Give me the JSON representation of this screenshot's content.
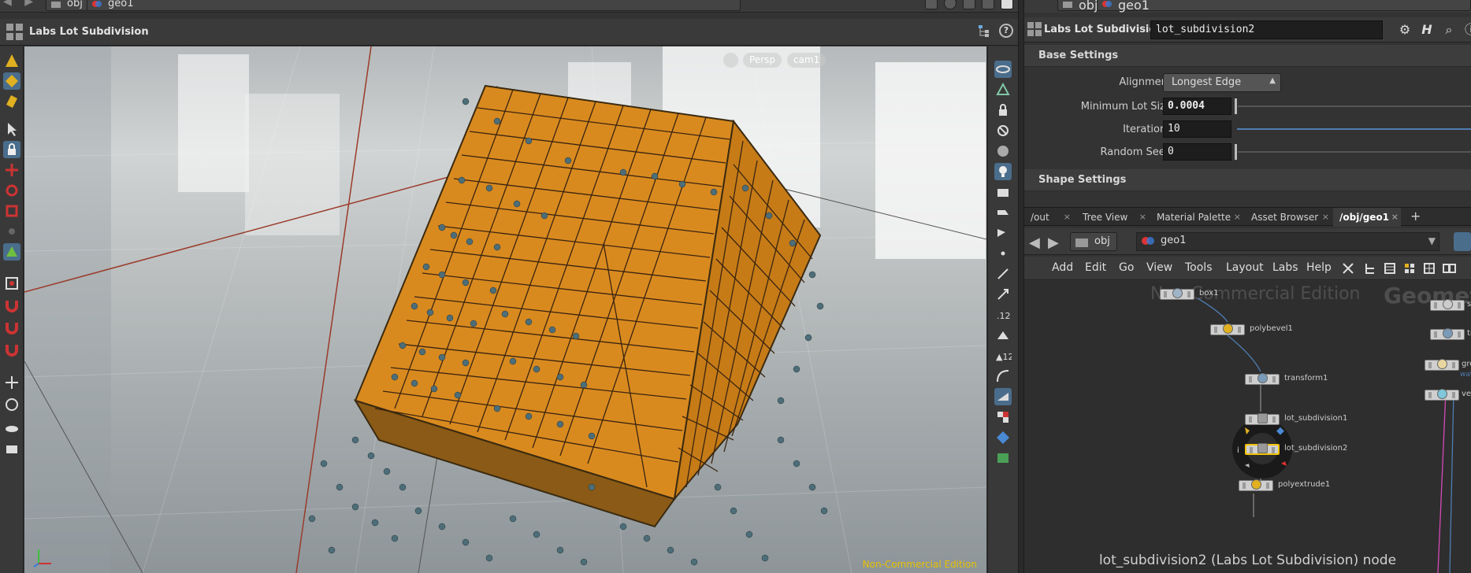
{
  "viewer": {
    "top_path": {
      "crumb_obj": "obj",
      "crumb_geo": "geo1"
    },
    "title": "Labs Lot Subdivision",
    "help_label": "?",
    "view_chips": {
      "persp": "Persp",
      "camera": "cam1"
    },
    "watermark": "Non-Commercial Edition"
  },
  "params": {
    "top_path": {
      "crumb_obj": "obj",
      "crumb_geo": "geo1"
    },
    "title": "Labs Lot Subdivision",
    "node_name": "lot_subdivision2",
    "folders": {
      "base": "Base Settings",
      "shape": "Shape Settings"
    },
    "alignment": {
      "label": "Alignment",
      "value": "Longest Edge"
    },
    "min_lot_size": {
      "label": "Minimum Lot Size",
      "value": "0.0004"
    },
    "iterations": {
      "label": "Iterations",
      "value": "10"
    },
    "random_seed": {
      "label": "Random Seed",
      "value": "0"
    }
  },
  "tabs": [
    {
      "label": "/out"
    },
    {
      "label": "Tree View"
    },
    {
      "label": "Material Palette"
    },
    {
      "label": "Asset Browser"
    },
    {
      "label": "/obj/geo1"
    }
  ],
  "add_tab": "+",
  "network": {
    "crumb_obj": "obj",
    "crumb_geo": "geo1",
    "menu": [
      "Add",
      "Edit",
      "Go",
      "View",
      "Tools",
      "Layout",
      "Labs",
      "Help"
    ],
    "watermark_nce": "Non-Commercial Edition",
    "watermark_geo": "Geometry",
    "nodes": {
      "box1": "box1",
      "polybevel1": "polybevel1",
      "transform1": "transform1",
      "lot_subdivision1": "lot_subdivision1",
      "lot_subdivision2": "lot_subdivision2",
      "polyextrude1": "polyextrude1",
      "sp": "sp",
      "tra": "tra",
      "grou": "grou",
      "wate": "wate",
      "ve": "ve"
    },
    "status": "lot_subdivision2 (Labs Lot Subdivision) node"
  },
  "colors": {
    "accent_yellow": "#f2c200",
    "cube_orange": "#d98a1f",
    "scatter_teal": "#4d6e78",
    "link_blue": "#4e7db3"
  }
}
